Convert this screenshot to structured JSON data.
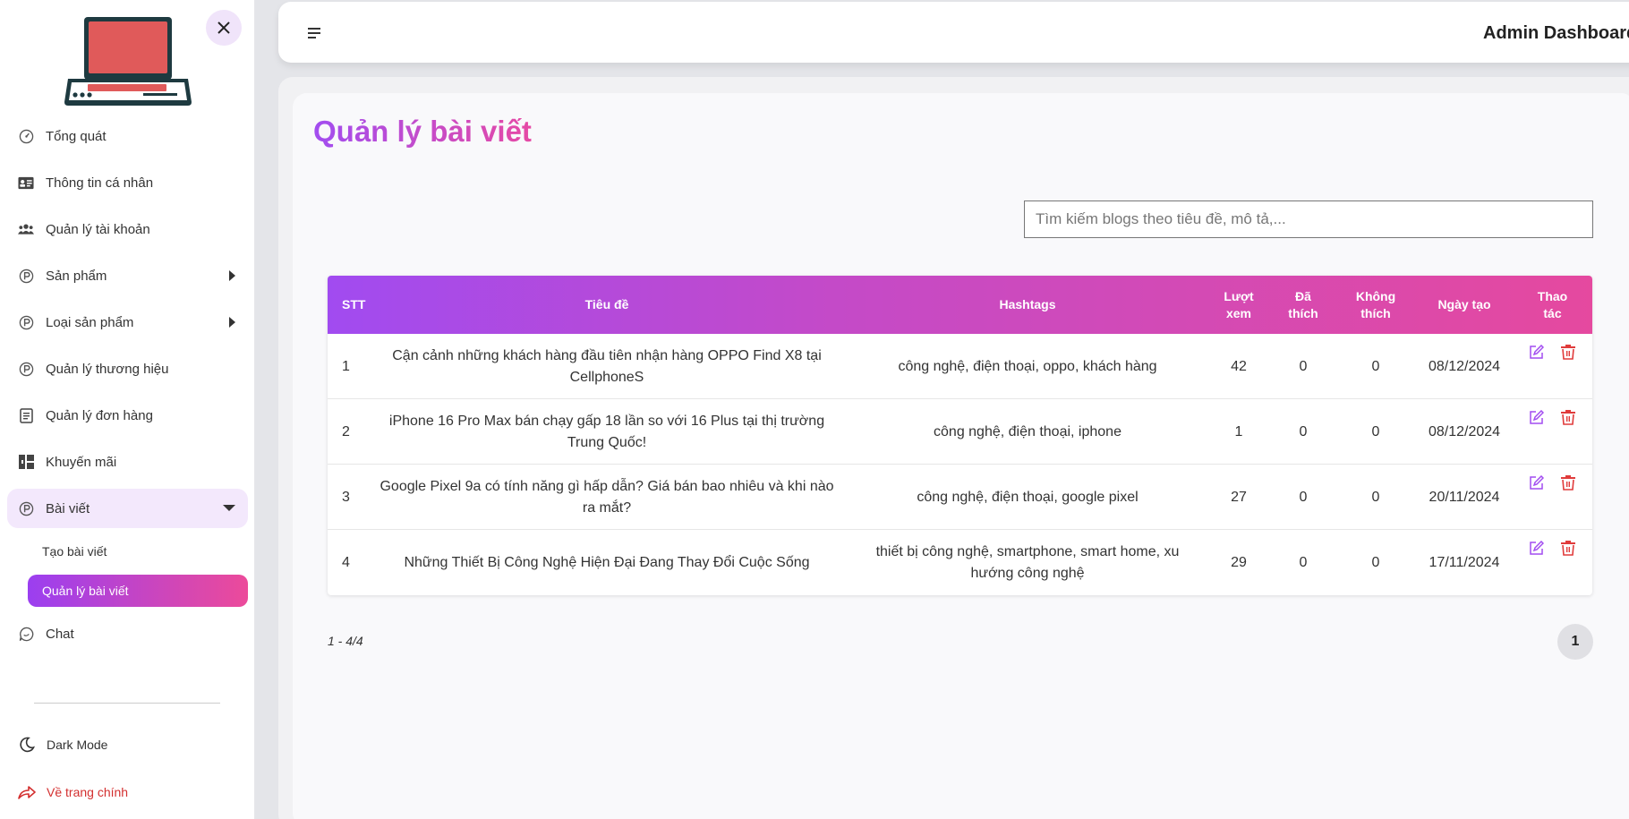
{
  "header": {
    "title": "Admin Dashboard"
  },
  "sidebar": {
    "items": [
      {
        "label": "Tổng quát",
        "icon": "dashboard-gauge-icon"
      },
      {
        "label": "Thông tin cá nhân",
        "icon": "id-card-icon"
      },
      {
        "label": "Quản lý tài khoản",
        "icon": "users-icon"
      },
      {
        "label": "Sản phẩm",
        "icon": "p-circle-icon",
        "expandable": true
      },
      {
        "label": "Loại sản phẩm",
        "icon": "p-circle-icon",
        "expandable": true
      },
      {
        "label": "Quản lý thương hiệu",
        "icon": "p-circle-icon"
      },
      {
        "label": "Quản lý đơn hàng",
        "icon": "document-icon"
      },
      {
        "label": "Khuyến mãi",
        "icon": "promotion-icon"
      },
      {
        "label": "Bài viết",
        "icon": "p-circle-icon",
        "expanded": true
      },
      {
        "label": "Chat",
        "icon": "chat-bubble-icon"
      }
    ],
    "sub_items": [
      {
        "label": "Tạo bài viết"
      },
      {
        "label": "Quản lý bài viết",
        "active": true
      }
    ],
    "dark_mode": "Dark Mode",
    "back_home": "Về trang chính"
  },
  "main": {
    "title": "Quản lý bài viết",
    "search_placeholder": "Tìm kiếm blogs theo tiêu đề, mô tả,..."
  },
  "table": {
    "columns": [
      "STT",
      "Tiêu đề",
      "Hashtags",
      "Lượt xem",
      "Đã thích",
      "Không thích",
      "Ngày tạo",
      "Thao tác"
    ],
    "rows": [
      {
        "stt": "1",
        "title": "Cận cảnh những khách hàng đầu tiên nhận hàng OPPO Find X8 tại CellphoneS",
        "hashtags": "công nghệ, điện thoại, oppo, khách hàng",
        "views": "42",
        "likes": "0",
        "dislikes": "0",
        "date": "08/12/2024"
      },
      {
        "stt": "2",
        "title": "iPhone 16 Pro Max bán chạy gấp 18 lần so với 16 Plus tại thị trường Trung Quốc!",
        "hashtags": "công nghệ, điện thoại, iphone",
        "views": "1",
        "likes": "0",
        "dislikes": "0",
        "date": "08/12/2024"
      },
      {
        "stt": "3",
        "title": "Google Pixel 9a có tính năng gì hấp dẫn? Giá bán bao nhiêu và khi nào ra mắt?",
        "hashtags": "công nghệ, điện thoại, google pixel",
        "views": "27",
        "likes": "0",
        "dislikes": "0",
        "date": "20/11/2024"
      },
      {
        "stt": "4",
        "title": "Những Thiết Bị Công Nghệ Hiện Đại Đang Thay Đổi Cuộc Sống",
        "hashtags": "thiết bị công nghệ, smartphone, smart home, xu hướng công nghệ",
        "views": "29",
        "likes": "0",
        "dislikes": "0",
        "date": "17/11/2024"
      }
    ]
  },
  "pagination": {
    "info": "1 - 4/4",
    "current_page": "1"
  },
  "colors": {
    "accent_start": "#a14bf0",
    "accent_end": "#e5499f",
    "edit": "#a24df0",
    "delete": "#e03b3b",
    "back_home": "#d32f2f"
  }
}
